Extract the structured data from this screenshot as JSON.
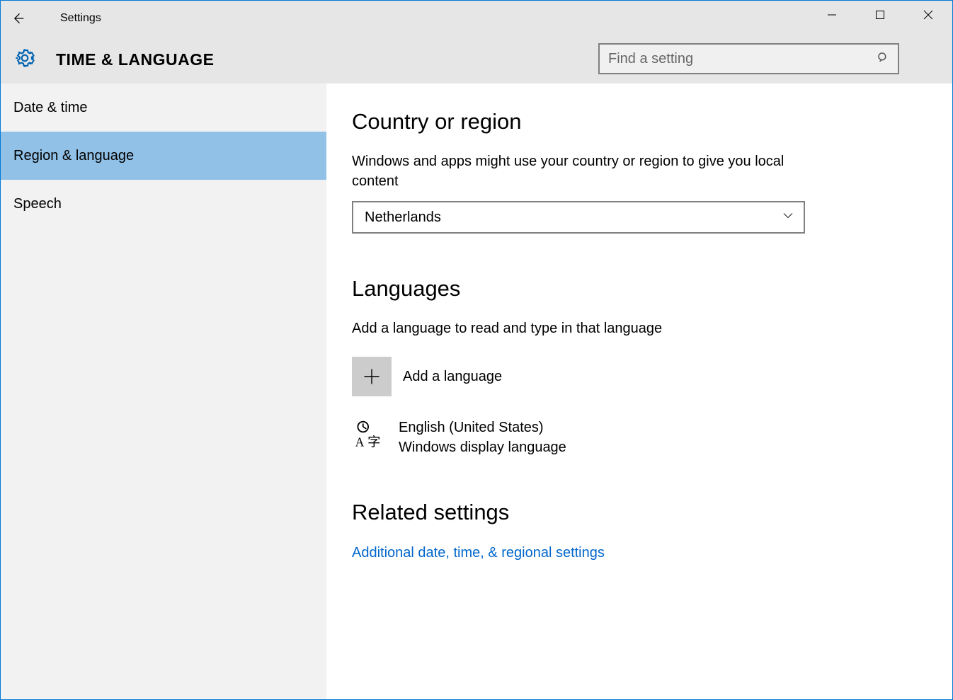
{
  "window": {
    "title": "Settings"
  },
  "header": {
    "page_title": "TIME & LANGUAGE",
    "search_placeholder": "Find a setting"
  },
  "sidebar": {
    "items": [
      {
        "label": "Date & time",
        "active": false
      },
      {
        "label": "Region & language",
        "active": true
      },
      {
        "label": "Speech",
        "active": false
      }
    ]
  },
  "main": {
    "country": {
      "title": "Country or region",
      "desc": "Windows and apps might use your country or region to give you local content",
      "selected": "Netherlands"
    },
    "languages": {
      "title": "Languages",
      "desc": "Add a language to read and type in that language",
      "add_label": "Add a language",
      "entries": [
        {
          "name": "English (United States)",
          "sub": "Windows display language"
        }
      ]
    },
    "related": {
      "title": "Related settings",
      "link": "Additional date, time, & regional settings"
    }
  }
}
